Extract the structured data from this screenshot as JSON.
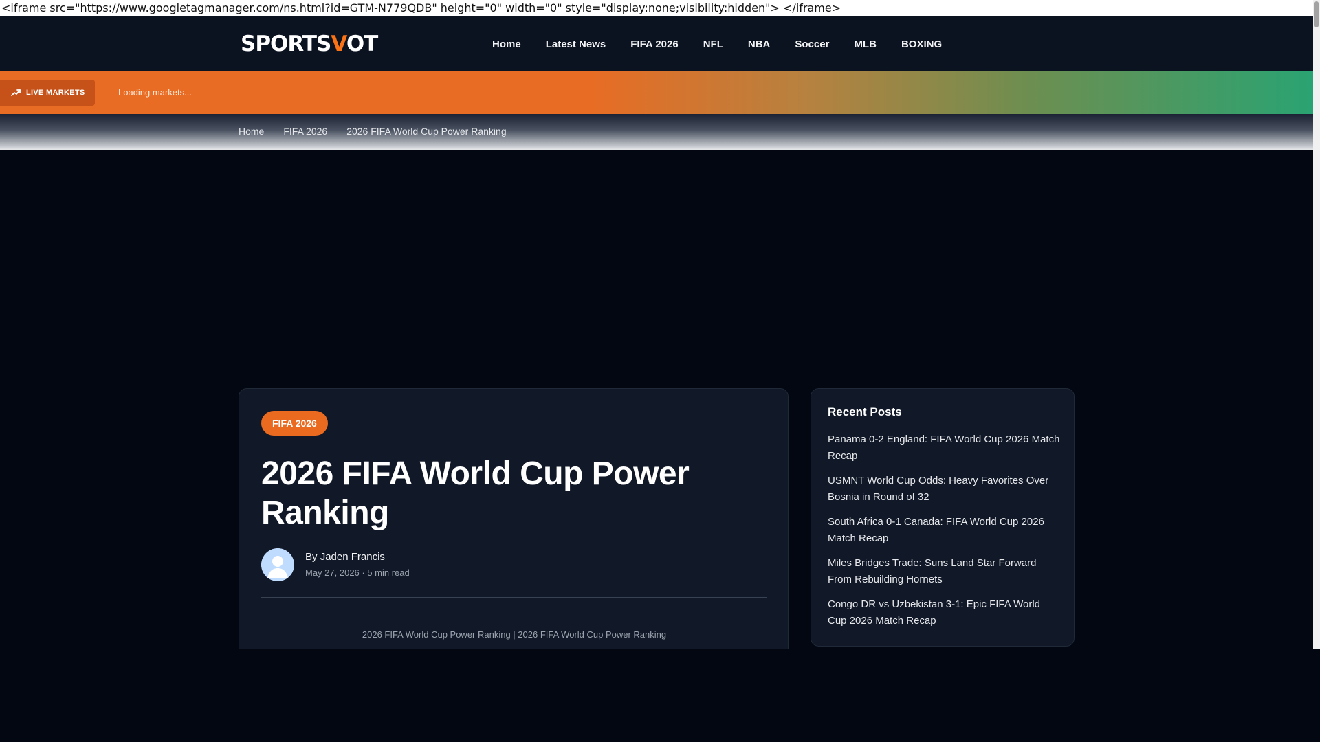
{
  "raw_markup_text": "<iframe src=\"https://www.googletagmanager.com/ns.html?id=GTM-N779QDB\" height=\"0\" width=\"0\" style=\"display:none;visibility:hidden\"> </iframe>",
  "header": {
    "logo_text_a": "SPORTS",
    "logo_text_v": "V",
    "logo_text_b": "OT",
    "nav": [
      "Home",
      "Latest News",
      "FIFA 2026",
      "NFL",
      "NBA",
      "Soccer",
      "MLB",
      "BOXING"
    ]
  },
  "ticker": {
    "badge_label": "LIVE MARKETS",
    "badge_icon": "trending-up-icon",
    "status_text": "Loading markets..."
  },
  "breadcrumb": [
    "Home",
    "FIFA 2026",
    "2026 FIFA World Cup Power Ranking"
  ],
  "article": {
    "category": "FIFA 2026",
    "title": "2026 FIFA World Cup Power Ranking",
    "author_prefix": "By",
    "author": "Jaden Francis",
    "meta": "May 27, 2026 · 5 min read",
    "image_caption": "2026 FIFA World Cup Power Ranking | 2026 FIFA World Cup Power Ranking"
  },
  "sidebar": {
    "title": "Recent Posts",
    "posts": [
      "Panama 0-2 England: FIFA World Cup 2026 Match Recap",
      "USMNT World Cup Odds: Heavy Favorites Over Bosnia in Round of 32",
      "South Africa 0-1 Canada: FIFA World Cup 2026 Match Recap",
      "Miles Bridges Trade: Suns Land Star Forward From Rebuilding Hornets",
      "Congo DR vs Uzbekistan 3-1: Epic FIFA World Cup 2026 Match Recap"
    ]
  },
  "colors": {
    "accent": "#ea6a20",
    "background": "#030712",
    "card": "#111827"
  }
}
